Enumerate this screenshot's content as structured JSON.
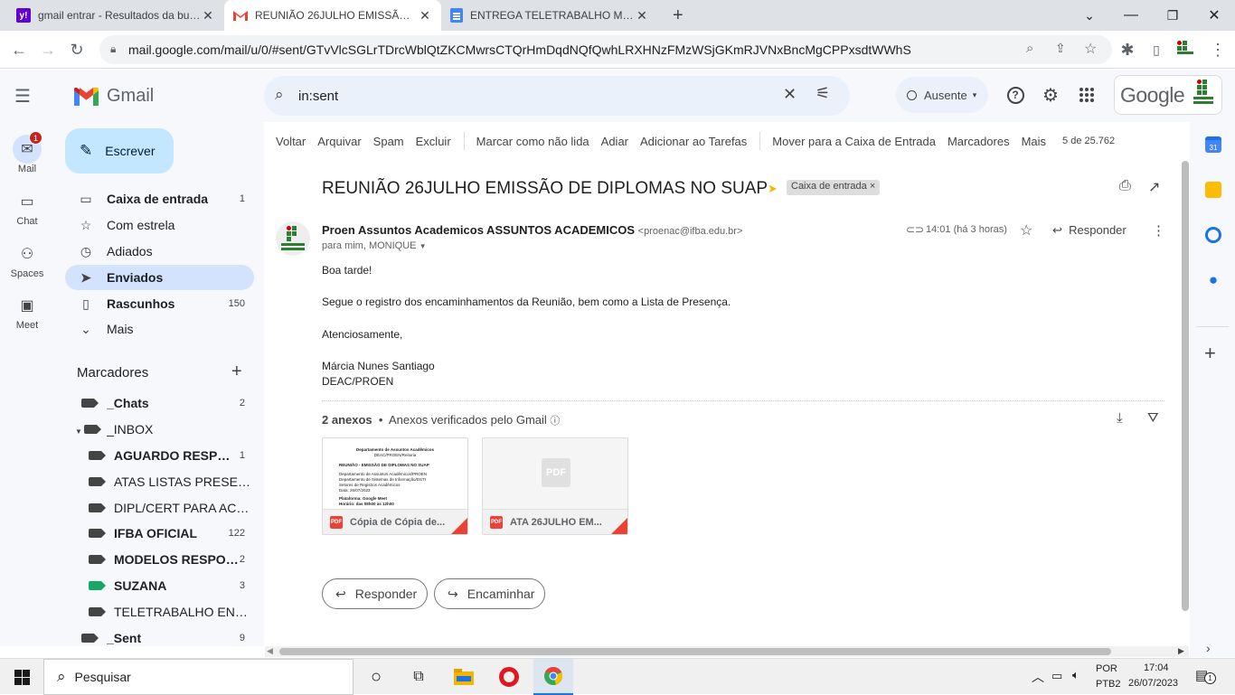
{
  "browser": {
    "tabs": [
      {
        "title": "gmail entrar - Resultados da busca",
        "icon": "yahoo-icon"
      },
      {
        "title": "REUNIÃO 26JULHO EMISSÃO DE DIPLOMAS",
        "icon": "gmail-icon"
      },
      {
        "title": "ENTREGA TELETRABALHO MARÇO",
        "icon": "docs-icon"
      }
    ],
    "url": "mail.google.com/mail/u/0/#sent/GTvVlcSGLrTDrcWblQtZKCMwrsCTQrHmDqdNQfQwhLRXHNzFMzWSjGKmRJVNxBncMgCPPxsdtWWhS"
  },
  "gmail": {
    "logo": "Gmail",
    "search_value": "in:sent",
    "status": "Ausente",
    "google": "Google",
    "rail": [
      {
        "label": "Mail",
        "badge": "1"
      },
      {
        "label": "Chat"
      },
      {
        "label": "Spaces"
      },
      {
        "label": "Meet"
      }
    ],
    "compose": "Escrever",
    "nav": [
      {
        "label": "Caixa de entrada",
        "count": "1"
      },
      {
        "label": "Com estrela",
        "count": ""
      },
      {
        "label": "Adiados",
        "count": ""
      },
      {
        "label": "Enviados",
        "count": ""
      },
      {
        "label": "Rascunhos",
        "count": "150"
      },
      {
        "label": "Mais",
        "count": ""
      }
    ],
    "labels_title": "Marcadores",
    "labels": [
      {
        "label": "_Chats",
        "count": "2"
      },
      {
        "label": "_INBOX",
        "count": ""
      },
      {
        "label": "AGUARDO RESPOSTA",
        "count": "1"
      },
      {
        "label": "ATAS LISTAS PRESENÇA",
        "count": ""
      },
      {
        "label": "DIPL/CERT PARA ACOMPANHAR",
        "count": ""
      },
      {
        "label": "IFBA OFICIAL",
        "count": "122"
      },
      {
        "label": "MODELOS RESPOSTA",
        "count": "2"
      },
      {
        "label": "SUZANA",
        "count": "3"
      },
      {
        "label": "TELETRABALHO ENTREGA",
        "count": ""
      },
      {
        "label": "_Sent",
        "count": "9"
      }
    ],
    "actions": [
      "Voltar",
      "Arquivar",
      "Spam",
      "Excluir",
      "Marcar como não lida",
      "Adiar",
      "Adicionar ao Tarefas",
      "Mover para a Caixa de Entrada",
      "Marcadores",
      "Mais"
    ],
    "pager": "5 de 25.762",
    "email": {
      "subject": "REUNIÃO 26JULHO EMISSÃO DE DIPLOMAS NO SUAP",
      "label_chip": "Caixa de entrada",
      "sender_name": "Proen Assuntos Academicos ASSUNTOS ACADEMICOS",
      "sender_email": "<proenac@ifba.edu.br>",
      "to": "para mim, MONIQUE",
      "time": "14:01 (há 3 horas)",
      "reply": "Responder",
      "body": [
        "Boa tarde!",
        "Segue o registro dos encaminhamentos da Reunião, bem como a Lista de Presença.",
        "Atenciosamente,",
        "Márcia Nunes Santiago",
        "DEAC/PROEN"
      ],
      "attachments_count": "2 anexos",
      "attachments_scan": "Anexos verificados pelo Gmail",
      "attachments": [
        {
          "name": "Cópia de Cópia de..."
        },
        {
          "name": "ATA 26JULHO EM..."
        }
      ],
      "preview_doc": {
        "title": "Departamento de Assuntos Acadêmicos",
        "subtitle": "DEAC/PROEN/Reitoria",
        "heading": "REUNIÃO - EMISSÃO DE DIPLOMAS NO SUAP",
        "lines": [
          "Departamento de Assuntos Acadêmicos/PROEN",
          "Departamento de Sistemas de Informação/DSTI",
          "Setores de Registros Acadêmicos",
          "Data: 26/07/2023"
        ],
        "platform": "Plataforma: Google Meet",
        "hours": "Horário: das 08h00 às 12h00"
      },
      "pdf_placeholder": "PDF",
      "reply_button": "Responder",
      "forward_button": "Encaminhar"
    }
  },
  "taskbar": {
    "search": "Pesquisar",
    "lang": "POR",
    "layout": "PTB2",
    "time": "17:04",
    "date": "26/07/2023",
    "notif": "1"
  },
  "colors": {
    "gmail_red": "#ea4335",
    "selected_nav": "#d3e3fd",
    "compose": "#c2e7ff",
    "accent_blue": "#0b57d0"
  }
}
